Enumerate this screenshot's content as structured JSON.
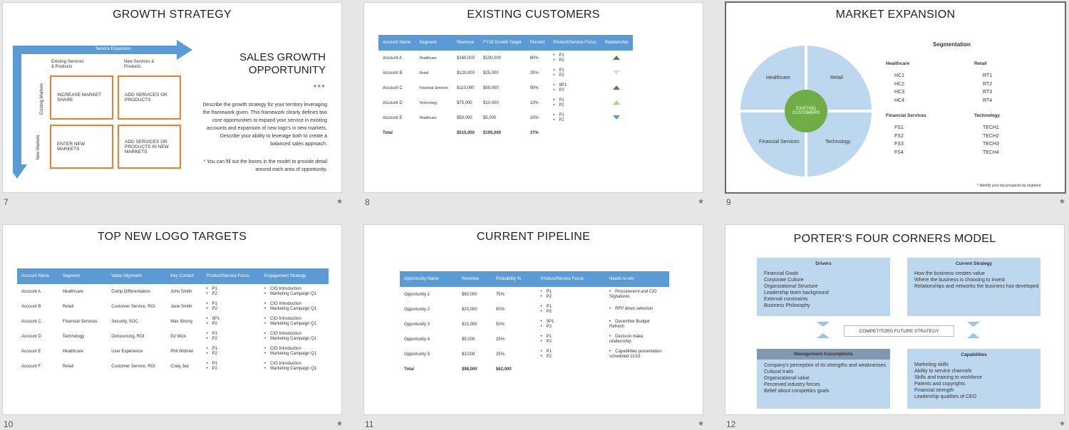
{
  "slides": {
    "s7": {
      "number": "7",
      "title": "GROWTH STRATEGY",
      "service_expansion": "Service Expansion",
      "market_expansion": "Market Expansion",
      "col_existing": "Existing Services\n& Products",
      "col_new": "New Services &\nProducts",
      "row_existing": "Existing Markets",
      "row_new": "New Markets",
      "box1": "INCREASE MARKET SHARE",
      "box2": "ADD SERVICES OR PRODUCTS",
      "box3": "ENTER NEW MARKETS",
      "box4": "ADD SERVICES OR PRODUCTS IN NEW MARKETS",
      "side_title": "SALES GROWTH OPPORTUNITY",
      "dots": "●●●",
      "description": "Describe the growth strategy for your territory leveraging the framework given.  This framework clearly defines two core opportunities to expand your service in existing accounts and expansion of new logo's in new markets.  Describe your ability to leverage both to create a balanced sales approach.",
      "note": "* You can fill out the boxes in the model to provide detail around each area of opportunity."
    },
    "s8": {
      "number": "8",
      "title": "EXISTING CUSTOMERS",
      "headers": [
        "Account Name",
        "Segment",
        "Revenue",
        "FY18 Growth Target",
        "Percent",
        "Product/Service Focus",
        "Relationship"
      ],
      "rows": [
        {
          "name": "Account A",
          "segment": "Healthcare",
          "revenue": "$160,000",
          "target": "$100,000",
          "percent": "60%",
          "focus": [
            "P1",
            "P2"
          ],
          "rel": "up-dark"
        },
        {
          "name": "Account B",
          "segment": "Retail",
          "revenue": "$120,000",
          "target": "$25,000",
          "percent": "20%",
          "focus": [
            "P1",
            "P2"
          ],
          "rel": "down-light"
        },
        {
          "name": "Account C",
          "segment": "Financial Services",
          "revenue": "$110,000",
          "target": "$55,000",
          "percent": "50%",
          "focus": [
            "9P1",
            "P2"
          ],
          "rel": "up-dark"
        },
        {
          "name": "Account D",
          "segment": "Technology",
          "revenue": "$75,000",
          "target": "$10,000",
          "percent": "13%",
          "focus": [
            "P1",
            "P2"
          ],
          "rel": "up-light"
        },
        {
          "name": "Account E",
          "segment": "Healthcare",
          "revenue": "$50,000",
          "target": "$5,000",
          "percent": "10%",
          "focus": [
            "P1",
            "P2"
          ],
          "rel": "down-blue"
        }
      ],
      "total": {
        "label": "Total",
        "revenue": "$515,000",
        "target": "$195,000",
        "percent": "37%"
      },
      "colors": {
        "up-dark": "#548235",
        "up-light": "#a9d18e",
        "down-light": "#d6dce4",
        "down-blue": "#5b9bd5"
      }
    },
    "s9": {
      "number": "9",
      "title": "MARKET EXPANSION",
      "quadrants": [
        "Healthcare",
        "Retail",
        "Financial Services",
        "Technology"
      ],
      "center": "EXISTING CUSTOMERS",
      "seg_title": "Segmentation",
      "groups": [
        {
          "name": "Healthcare",
          "items": [
            "HC1",
            "HC2",
            "HC3",
            "HC4"
          ]
        },
        {
          "name": "Retail",
          "items": [
            "RT1",
            "RT2",
            "RT3",
            "RT4"
          ]
        },
        {
          "name": "Financial Services",
          "items": [
            "FS1",
            "FS2",
            "FS3",
            "FS4"
          ]
        },
        {
          "name": "Technology",
          "items": [
            "TECH1",
            "TECH2",
            "TECH3",
            "TECH4"
          ]
        }
      ],
      "footnote": "* Identify your top prospects by segment"
    },
    "s10": {
      "number": "10",
      "title": "TOP NEW LOGO TARGETS",
      "headers": [
        "Account Name",
        "Segment",
        "Value Alignment",
        "Key Contact",
        "Product/Service Focus",
        "Engagement Strategy"
      ],
      "rows": [
        {
          "name": "Account A",
          "segment": "Healthcare",
          "value": "Comp Differentiation",
          "contact": "John Smith",
          "focus": [
            "P1",
            "P2"
          ],
          "strategy": [
            "CIO Introduction",
            "Marketing Campaign Q1"
          ]
        },
        {
          "name": "Account B",
          "segment": "Retail",
          "value": "Customer Service, ROI",
          "contact": "Jane Smith",
          "focus": [
            "P1",
            "P2"
          ],
          "strategy": [
            "CIO Introduction",
            "Marketing Campaign Q1"
          ]
        },
        {
          "name": "Account C",
          "segment": "Financial Services",
          "value": "Security, SOC",
          "contact": "Max Strong",
          "focus": [
            "9P1",
            "P2"
          ],
          "strategy": [
            "CIO Introduction",
            "Marketing Campaign Q1"
          ]
        },
        {
          "name": "Account D",
          "segment": "Technology",
          "value": "Outsourcing, ROI",
          "contact": "Ed Wick",
          "focus": [
            "P1",
            "P2"
          ],
          "strategy": [
            "CIO Introduction",
            "Marketing Campaign Q1"
          ]
        },
        {
          "name": "Account E",
          "segment": "Healthcare",
          "value": "User Experience",
          "contact": "Phil Widmer",
          "focus": [
            "P1",
            "P2"
          ],
          "strategy": [
            "CIO Introduction",
            "Marketing Campaign Q1"
          ]
        },
        {
          "name": "Account F",
          "segment": "Retail",
          "value": "Customer Service, ROI",
          "contact": "Craig Jep",
          "focus": [
            "P1",
            "P2"
          ],
          "strategy": [
            "CIO Introduction",
            "Marketing Campaign Q1"
          ]
        }
      ]
    },
    "s11": {
      "number": "11",
      "title": "CURRENT PIPELINE",
      "headers": [
        "Opportunity Name",
        "Revenue",
        "Probability %",
        "Product/Service Focus",
        "Needs to win"
      ],
      "rows": [
        {
          "name": "Opportunity 1",
          "revenue": "$60,000",
          "prob": "75%",
          "focus": [
            "P1",
            "P2"
          ],
          "needs": [
            "Procurement and CIO Signatures"
          ]
        },
        {
          "name": "Opportunity 2",
          "revenue": "$20,000",
          "prob": "50%",
          "focus": [
            "P1",
            "P2"
          ],
          "needs": [
            "RFP down selection"
          ]
        },
        {
          "name": "Opportunity 3",
          "revenue": "$10,000",
          "prob": "50%",
          "focus": [
            "9P1",
            "P2"
          ],
          "needs": [
            "December Budget Refresh"
          ]
        },
        {
          "name": "Opportunity 4",
          "revenue": "$5,000",
          "prob": "25%",
          "focus": [
            "P1",
            "P2"
          ],
          "needs": [
            "Decision make relationship"
          ]
        },
        {
          "name": "Opportunity 5",
          "revenue": "$3,000",
          "prob": "25%",
          "focus": [
            "P1",
            "P2"
          ],
          "needs": [
            "Capabilities presentation scheduled 11/15"
          ]
        }
      ],
      "total": {
        "label": "Total",
        "revenue": "$98,000",
        "prob": "$62,000"
      }
    },
    "s12": {
      "number": "12",
      "title": "PORTER'S FOUR CORNERS MODEL",
      "drivers": {
        "title": "Drivers",
        "items": [
          "Financial Goals",
          "Corporate Culture",
          "Organizational Structure",
          "Leadership team background",
          "External constraints",
          "Business Philosophy"
        ]
      },
      "current": {
        "title": "Current Strategy",
        "items": [
          "How the business creates value",
          "Where the business is choosing to invest",
          "Relationships and networks the business has developed"
        ]
      },
      "center": "COMPETITORS FUTURE STRATEGY",
      "assumptions": {
        "title": "Management Assumptions",
        "items": [
          "Company's perception of its strengths and weaknesses",
          "Cultural traits",
          "Organizational value",
          "Perceived industry forces",
          "Belief about competitirs goals"
        ]
      },
      "capabilities": {
        "title": "Capabilities",
        "items": [
          "Marketing skills",
          "Ability to service channels",
          "Skills and training to workforce",
          "Patents and copyrights",
          "Financial strength",
          "Leadership qualities of CEO"
        ]
      }
    }
  },
  "star_icon": "★",
  "colors": {
    "accent_blue": "#5b9bd5",
    "orange": "#ed7d31",
    "light_blue": "#bdd7ee",
    "green": "#70ad47",
    "header_gray": "#8497b0"
  }
}
